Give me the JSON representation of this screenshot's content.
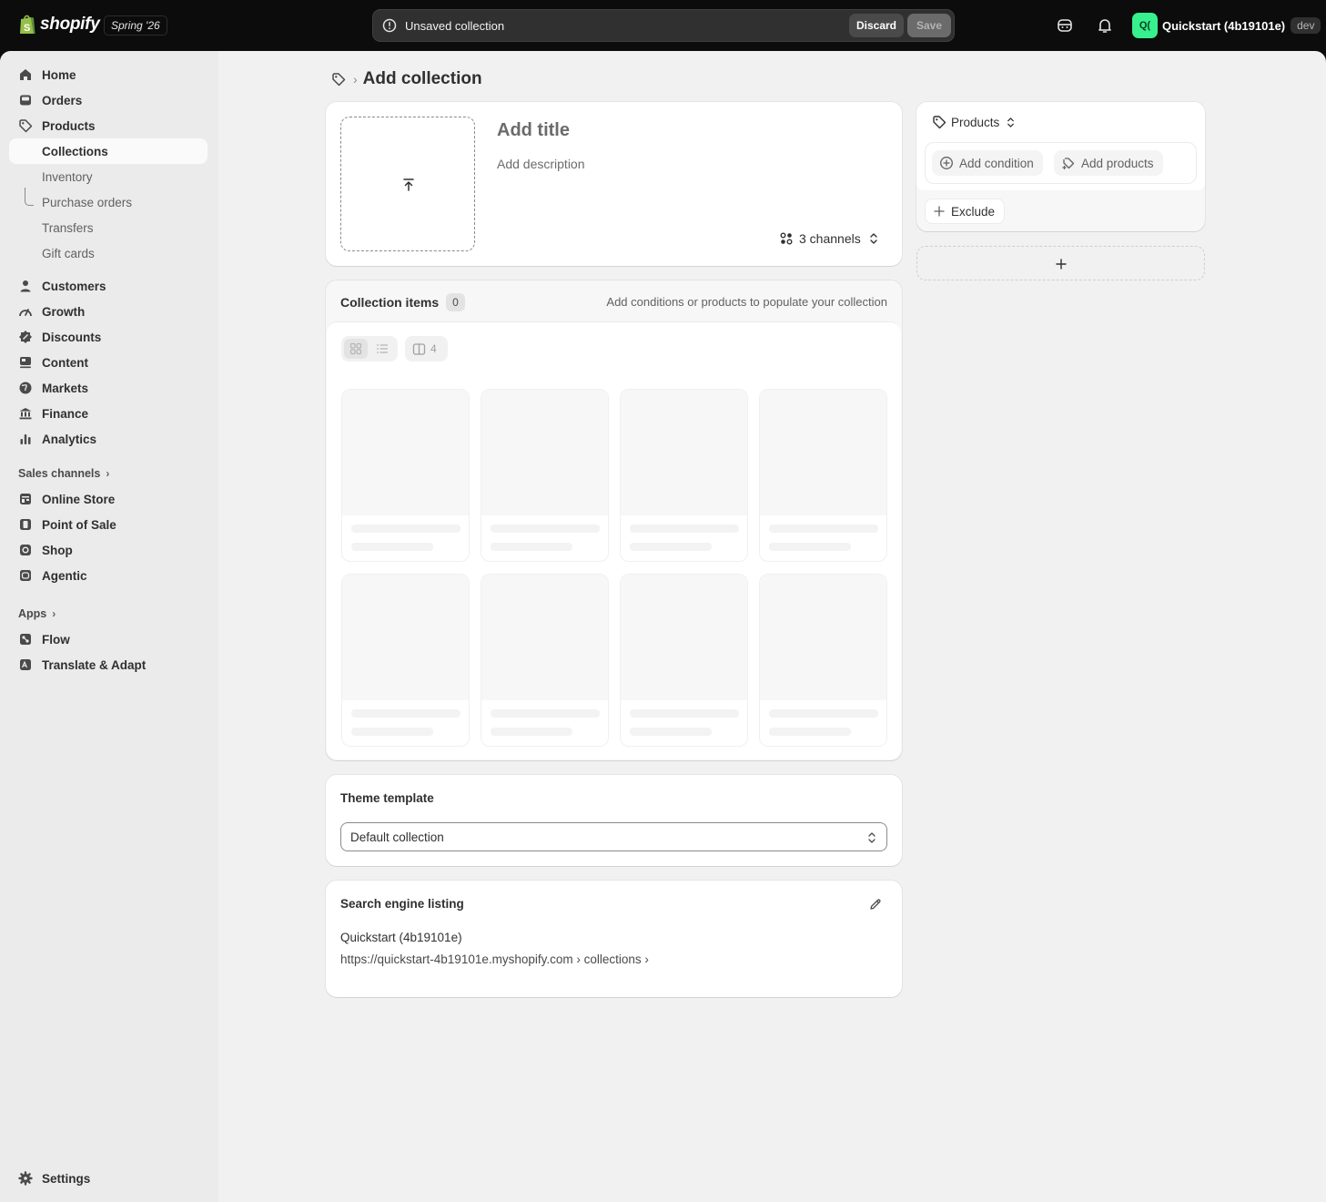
{
  "topbar": {
    "brand": "shopify",
    "edition": "Spring '26",
    "savebar_message": "Unsaved collection",
    "discard_label": "Discard",
    "save_label": "Save",
    "store_initials": "Q(",
    "store_name": "Quickstart (4b19101e)",
    "env_badge": "dev",
    "icons": [
      "alert-circle-icon",
      "sidekick-icon",
      "bell-icon"
    ]
  },
  "sidebar": {
    "items": [
      {
        "label": "Home",
        "icon": "home-icon"
      },
      {
        "label": "Orders",
        "icon": "inbox-icon"
      },
      {
        "label": "Products",
        "icon": "tag-icon"
      },
      {
        "label": "Collections",
        "active": true
      },
      {
        "label": "Inventory"
      },
      {
        "label": "Purchase orders"
      },
      {
        "label": "Transfers"
      },
      {
        "label": "Gift cards"
      },
      {
        "label": "Customers",
        "icon": "person-icon"
      },
      {
        "label": "Growth",
        "icon": "gauge-icon"
      },
      {
        "label": "Discounts",
        "icon": "discount-icon"
      },
      {
        "label": "Content",
        "icon": "content-icon"
      },
      {
        "label": "Markets",
        "icon": "globe-icon"
      },
      {
        "label": "Finance",
        "icon": "bank-icon"
      },
      {
        "label": "Analytics",
        "icon": "bar-chart-icon"
      }
    ],
    "sales_channels_heading": "Sales channels",
    "sales_channels": [
      {
        "label": "Online Store",
        "icon": "online-store-icon"
      },
      {
        "label": "Point of Sale",
        "icon": "pos-icon"
      },
      {
        "label": "Shop",
        "icon": "shop-icon"
      },
      {
        "label": "Agentic",
        "icon": "agentic-icon"
      }
    ],
    "apps_heading": "Apps",
    "apps": [
      {
        "label": "Flow",
        "icon": "flow-icon"
      },
      {
        "label": "Translate & Adapt",
        "icon": "translate-icon"
      }
    ],
    "settings_label": "Settings"
  },
  "main": {
    "page_title": "Add collection",
    "title_placeholder": "Add title",
    "description_placeholder": "Add description",
    "channels_label": "3 channels",
    "collection_items": {
      "title": "Collection items",
      "count": "0",
      "hint": "Add conditions or products to populate your collection",
      "columns_count": "4",
      "skeleton_cards": 8
    },
    "theme_template": {
      "title": "Theme template",
      "selected": "Default collection"
    },
    "seo": {
      "title": "Search engine listing",
      "store_name": "Quickstart (4b19101e)",
      "url": "https://quickstart-4b19101e.myshopify.com › collections ›"
    }
  },
  "right": {
    "type_label": "Products",
    "add_condition_label": "Add condition",
    "add_products_label": "Add products",
    "exclude_label": "Exclude"
  }
}
